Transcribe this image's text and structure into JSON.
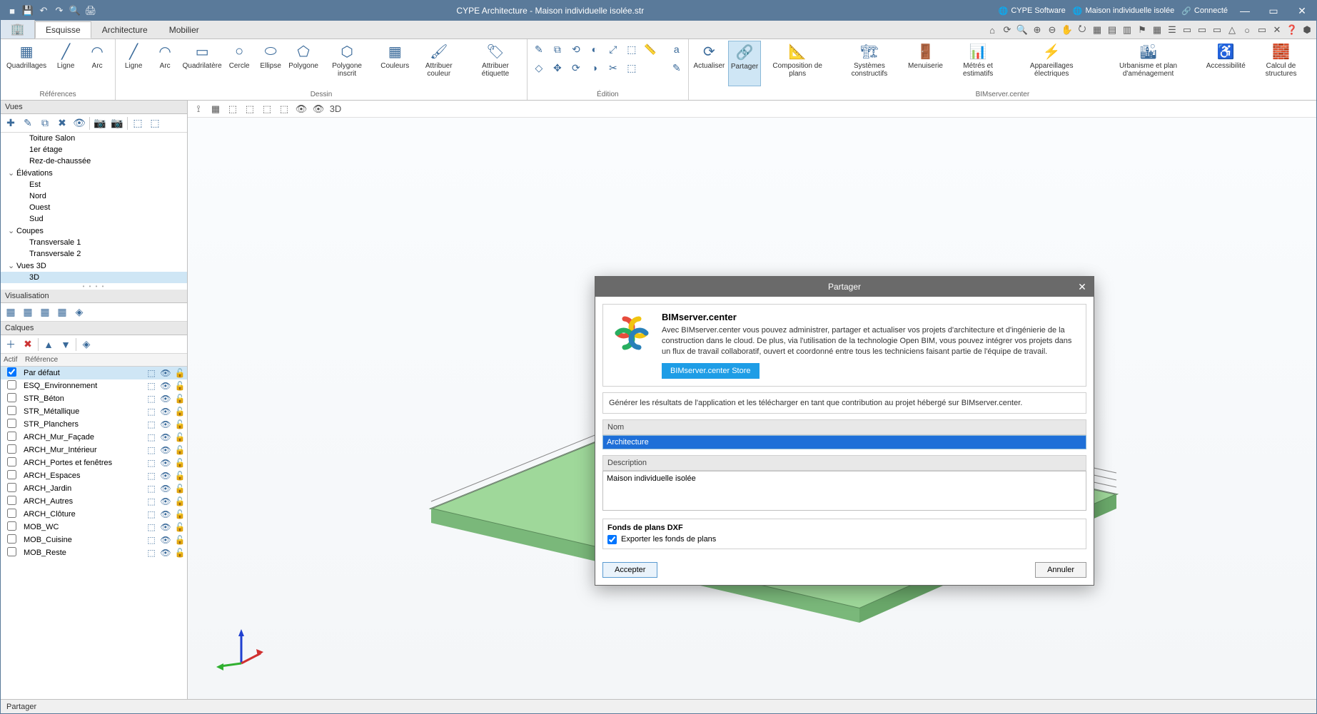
{
  "title_bar": {
    "app_title": "CYPE Architecture - Maison individuelle isolée.str",
    "software": "CYPE Software",
    "project": "Maison individuelle isolée",
    "connection": "Connecté"
  },
  "tabs": {
    "esquisse": "Esquisse",
    "architecture": "Architecture",
    "mobilier": "Mobilier"
  },
  "ribbon": {
    "references": {
      "label": "Références",
      "quadrillages": "Quadrillages",
      "ligne": "Ligne",
      "arc": "Arc"
    },
    "dessin": {
      "label": "Dessin",
      "ligne": "Ligne",
      "arc": "Arc",
      "quadrilatere": "Quadrilatère",
      "cercle": "Cercle",
      "ellipse": "Ellipse",
      "polygone": "Polygone",
      "polygone_inscrit": "Polygone inscrit",
      "couleurs": "Couleurs",
      "attribuer_couleur": "Attribuer couleur",
      "attribuer_etiquette": "Attribuer étiquette"
    },
    "edition": {
      "label": "Édition"
    },
    "bim": {
      "label": "BIMserver.center",
      "actualiser": "Actualiser",
      "partager": "Partager",
      "composition": "Composition de plans",
      "systemes": "Systèmes constructifs",
      "menuiserie": "Menuiserie",
      "metres": "Métrés et estimatifs",
      "appareillages": "Appareillages électriques",
      "urbanisme": "Urbanisme et plan d'aménagement",
      "accessibilite": "Accessibilité",
      "calcul": "Calcul de structures"
    }
  },
  "panels": {
    "vues": "Vues",
    "visualisation": "Visualisation",
    "calques": "Calques",
    "layers_head_actif": "Actif",
    "layers_head_ref": "Référence"
  },
  "tree": {
    "toiture": "Toiture Salon",
    "etage": "1er étage",
    "rdc": "Rez-de-chaussée",
    "elevations": "Élévations",
    "est": "Est",
    "nord": "Nord",
    "ouest": "Ouest",
    "sud": "Sud",
    "coupes": "Coupes",
    "trans1": "Transversale 1",
    "trans2": "Transversale 2",
    "vues3d": "Vues 3D",
    "v3d": "3D"
  },
  "layers": [
    {
      "name": "Par défaut",
      "checked": true,
      "sel": true
    },
    {
      "name": "ESQ_Environnement",
      "checked": false
    },
    {
      "name": "STR_Béton",
      "checked": false
    },
    {
      "name": "STR_Métallique",
      "checked": false
    },
    {
      "name": "STR_Planchers",
      "checked": false
    },
    {
      "name": "ARCH_Mur_Façade",
      "checked": false
    },
    {
      "name": "ARCH_Mur_Intérieur",
      "checked": false
    },
    {
      "name": "ARCH_Portes et fenêtres",
      "checked": false
    },
    {
      "name": "ARCH_Espaces",
      "checked": false
    },
    {
      "name": "ARCH_Jardin",
      "checked": false
    },
    {
      "name": "ARCH_Autres",
      "checked": false
    },
    {
      "name": "ARCH_Clôture",
      "checked": false
    },
    {
      "name": "MOB_WC",
      "checked": false
    },
    {
      "name": "MOB_Cuisine",
      "checked": false
    },
    {
      "name": "MOB_Reste",
      "checked": false
    }
  ],
  "dialog": {
    "title": "Partager",
    "heading": "BIMserver.center",
    "intro": "Avec BIMserver.center vous pouvez administrer, partager et actualiser vos projets d'architecture et d'ingénierie de la construction dans le cloud. De plus, via l'utilisation de la technologie Open BIM, vous pouvez intégrer vos projets dans un flux de travail collaboratif, ouvert et coordonné entre tous les techniciens faisant partie de l'équipe de travail.",
    "store_btn": "BIMserver.center Store",
    "subtext": "Générer les résultats de l'application et les télécharger en tant que contribution au projet hébergé sur BIMserver.center.",
    "nom_label": "Nom",
    "nom_value": "Architecture",
    "desc_label": "Description",
    "desc_value": "Maison individuelle isolée",
    "dxf_label": "Fonds de plans DXF",
    "export_label": "Exporter les fonds de plans",
    "accepter": "Accepter",
    "annuler": "Annuler"
  },
  "status": {
    "text": "Partager"
  }
}
